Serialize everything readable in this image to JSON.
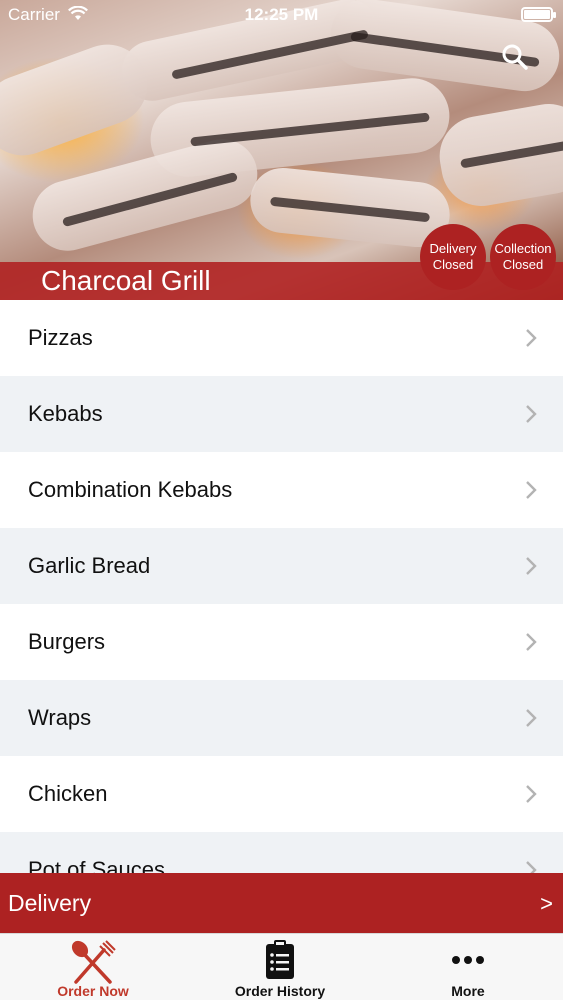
{
  "status": {
    "carrier": "Carrier",
    "time": "12:25 PM"
  },
  "header": {
    "title": "Charcoal Grill",
    "delivery_badge": {
      "line1": "Delivery",
      "line2": "Closed"
    },
    "collection_badge": {
      "line1": "Collection",
      "line2": "Closed"
    }
  },
  "menu": {
    "items": [
      {
        "label": "Pizzas"
      },
      {
        "label": "Kebabs"
      },
      {
        "label": "Combination Kebabs"
      },
      {
        "label": "Garlic Bread"
      },
      {
        "label": "Burgers"
      },
      {
        "label": "Wraps"
      },
      {
        "label": "Chicken"
      },
      {
        "label": "Pot of Sauces"
      }
    ]
  },
  "delivery_bar": {
    "label": "Delivery",
    "arrow": ">"
  },
  "tabs": [
    {
      "label": "Order Now",
      "icon": "fork-knife-icon"
    },
    {
      "label": "Order History",
      "icon": "clipboard-icon"
    },
    {
      "label": "More",
      "icon": "more-dots-icon"
    }
  ],
  "colors": {
    "accent": "#ad2222",
    "active_tab": "#c0392b",
    "alt_row": "#eff2f5"
  }
}
